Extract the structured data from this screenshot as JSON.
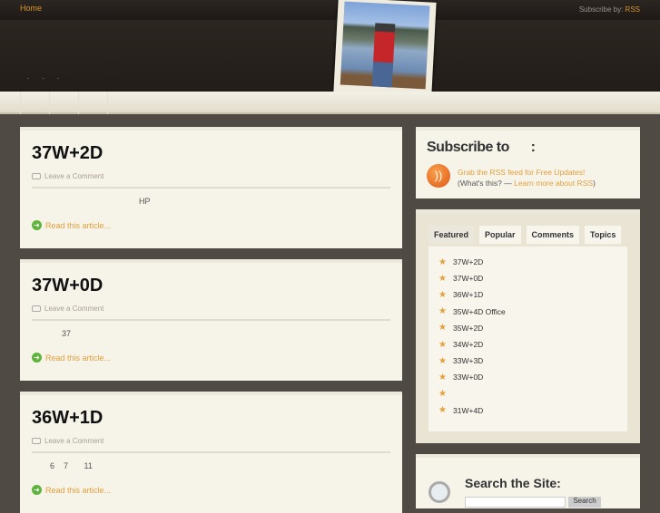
{
  "header": {
    "home": "Home",
    "subscribe_by": "Subscribe by:",
    "rss": "RSS",
    "dots": ". . ."
  },
  "posts": [
    {
      "title": "37W+2D",
      "comment": "Leave a Comment",
      "excerpt": "HP",
      "read": "Read this article..."
    },
    {
      "title": "37W+0D",
      "comment": "Leave a Comment",
      "excerpt": "37",
      "read": "Read this article..."
    },
    {
      "title": "36W+1D",
      "comment": "Leave a Comment",
      "excerpt": "6    7       11",
      "read": "Read this article..."
    }
  ],
  "subscribe": {
    "title": "Subscribe to      :",
    "grab": "Grab the RSS feed for Free Updates!",
    "whats": "(What's this? — ",
    "learn": "Learn more about RSS",
    "close": ")"
  },
  "tabs": {
    "items": [
      "Featured",
      "Popular",
      "Comments",
      "Topics"
    ],
    "list": [
      "37W+2D",
      "37W+0D",
      "36W+1D",
      "35W+4D Office",
      "35W+2D",
      "34W+2D",
      "33W+3D",
      "33W+0D",
      "",
      "31W+4D"
    ]
  },
  "search": {
    "title": "Search the Site:",
    "button": "Search"
  }
}
